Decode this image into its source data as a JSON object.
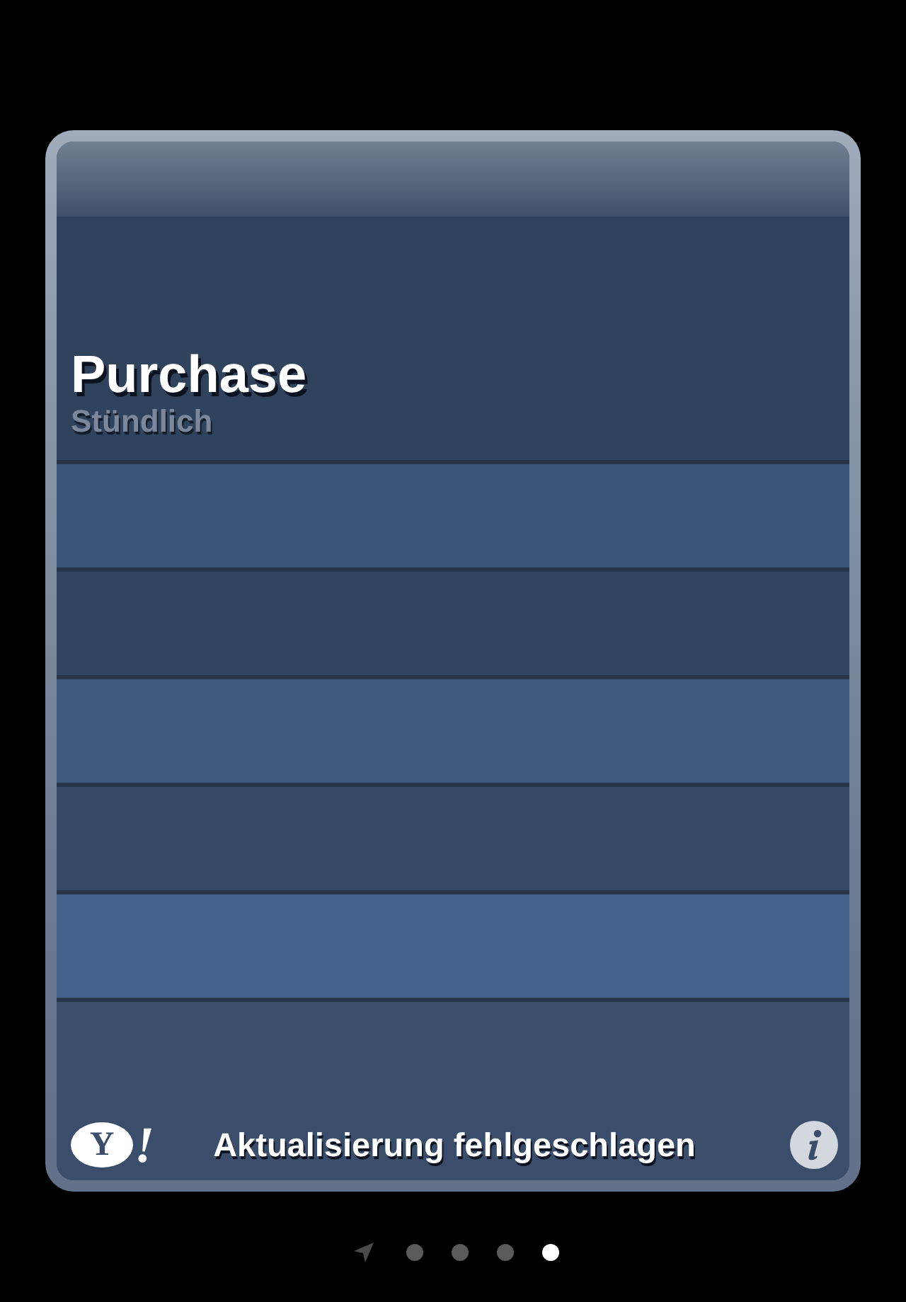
{
  "card": {
    "title": "Purchase",
    "subtitle": "Stündlich"
  },
  "footer": {
    "logo": {
      "letter": "Y",
      "exclamation": "!"
    },
    "status": "Aktualisierung fehlgeschlagen"
  },
  "page_indicator": [
    {
      "selected": false
    },
    {
      "selected": false
    },
    {
      "selected": false
    },
    {
      "selected": true
    }
  ]
}
